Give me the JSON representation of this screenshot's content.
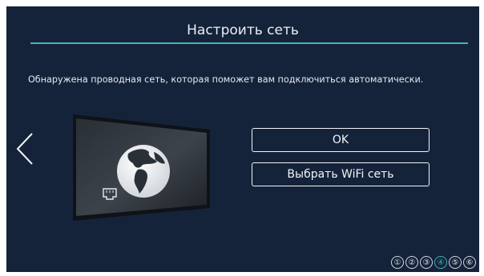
{
  "header": {
    "title": "Настроить сеть"
  },
  "message": "Обнаружена проводная сеть, которая поможет вам подключиться автоматически.",
  "buttons": {
    "ok_label": "OK",
    "wifi_label": "Выбрать WiFi сеть"
  },
  "steps": {
    "items": [
      "①",
      "②",
      "③",
      "④",
      "⑤",
      "⑥"
    ],
    "current": 4
  },
  "icons": {
    "back": "chevron-left-icon",
    "tv": "tv-illustration-icon",
    "globe": "globe-icon",
    "ethernet": "ethernet-port-icon"
  },
  "colors": {
    "accent": "#43b3b3",
    "background": "#15233a",
    "text": "#e9eef5"
  }
}
